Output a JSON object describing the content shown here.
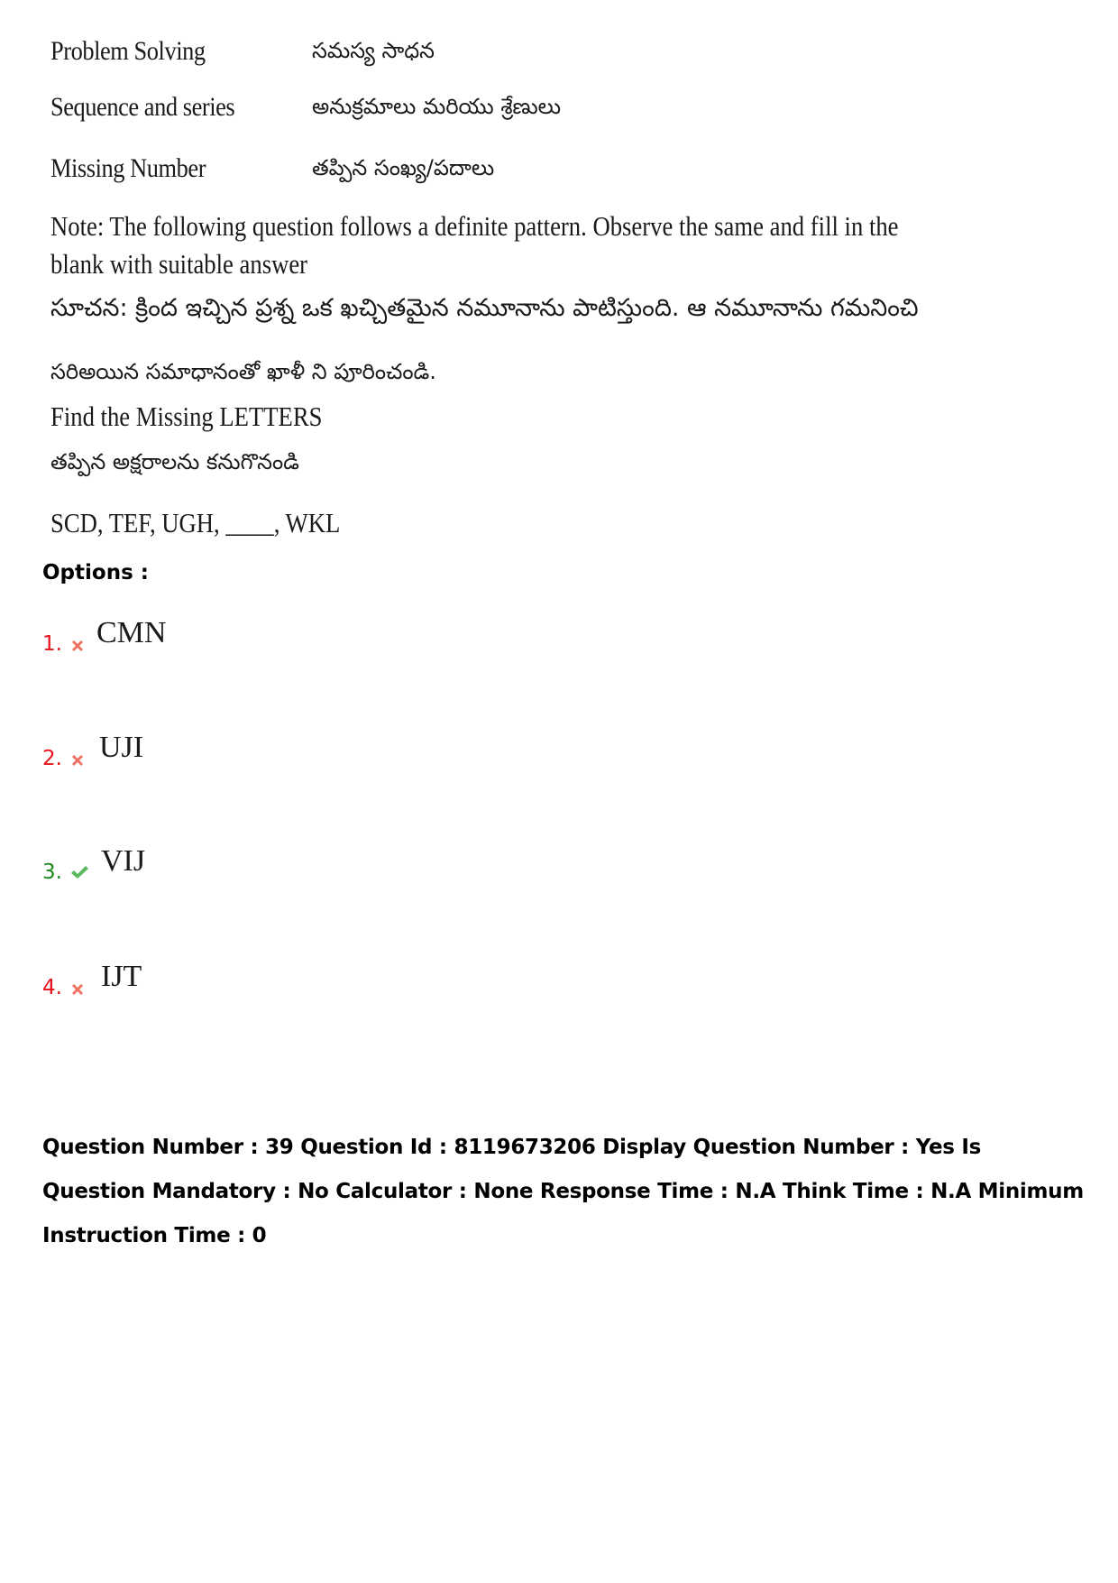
{
  "question": {
    "topics": [
      {
        "en": "Problem Solving",
        "te": "సమస్య సాధన"
      },
      {
        "en": "Sequence and series",
        "te": "అనుక్రమాలు మరియు శ్రేణులు"
      },
      {
        "en": "Missing Number",
        "te": "తప్పిన సంఖ్య/పదాలు"
      }
    ],
    "note_en_line1": "Note:  The following question follows a definite pattern. Observe the same and fill in the",
    "note_en_line2": "blank with suitable answer",
    "note_te_line1": "సూచన: క్రింద  ఇచ్చిన ప్రశ్న  ఒక ఖచ్చితమైన నమూనాను పాటిస్తుంది. ఆ నమూనాను గమనించి",
    "note_te_line2": "సరిఅయిన సమాధానంతో ఖాళీ ని పూరించండి.",
    "instruction_en": "Find the Missing LETTERS",
    "instruction_te": "తప్పిన అక్షరాలను  కనుగొనండి",
    "series": "SCD, TEF, UGH, ____, WKL"
  },
  "options_label": "Options :",
  "options": [
    {
      "number": "1.",
      "text": "CMN",
      "status": "wrong",
      "icon": "cross-icon"
    },
    {
      "number": "2.",
      "text": "UJI",
      "status": "wrong",
      "icon": "cross-icon"
    },
    {
      "number": "3.",
      "text": "VIJ",
      "status": "correct",
      "icon": "check-icon"
    },
    {
      "number": "4.",
      "text": "IJT",
      "status": "wrong",
      "icon": "cross-icon"
    }
  ],
  "colors": {
    "wrong": "#e8101a",
    "correct": "#1e8a1e",
    "cross_icon": "#f07060",
    "check_icon": "#5cb85c"
  },
  "meta": {
    "text": "Question Number : 39 Question Id : 8119673206 Display Question Number : Yes Is Question Mandatory : No Calculator : None Response Time : N.A Think Time : N.A Minimum Instruction Time : 0"
  }
}
